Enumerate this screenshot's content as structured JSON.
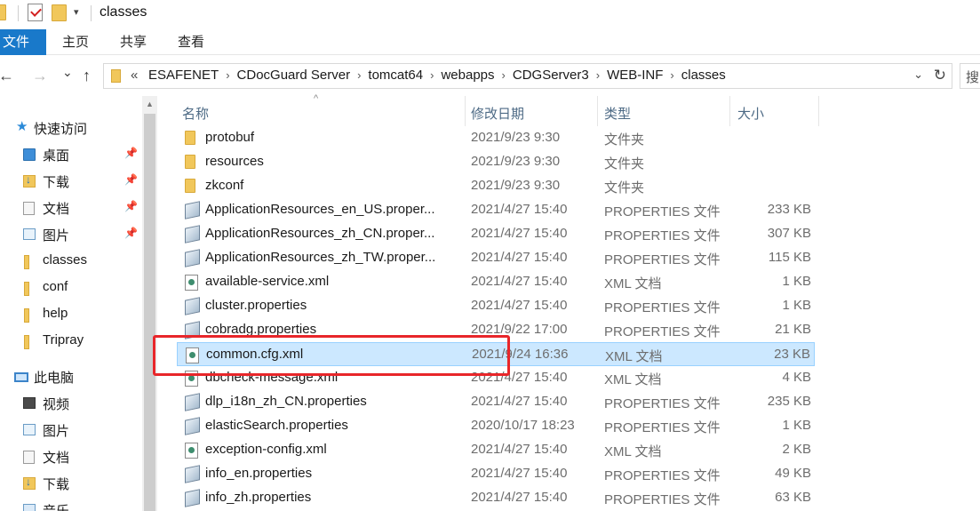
{
  "window": {
    "title": "classes"
  },
  "quick_access_toolbar": {
    "icons": [
      "folder-icon",
      "properties-icon",
      "new-folder-icon",
      "dropdown-icon"
    ],
    "dropdown_glyph": "▾"
  },
  "ribbon": {
    "tabs": [
      "文件",
      "主页",
      "共享",
      "查看"
    ],
    "active": "文件",
    "accent": "#1979ca"
  },
  "navigation": {
    "back": "←",
    "forward": "→",
    "recent": "⌄",
    "up": "↑",
    "overflow": "«",
    "breadcrumbs": [
      "ESAFENET",
      "CDocGuard Server",
      "tomcat64",
      "webapps",
      "CDGServer3",
      "WEB-INF",
      "classes"
    ],
    "crumb_sep": "›",
    "dropdown": "⌄",
    "refresh": "↻",
    "search_placeholder": "搜"
  },
  "sidebar": {
    "items": [
      {
        "label": "快速访问",
        "icon": "star-icon",
        "pinned": false
      },
      {
        "label": "桌面",
        "icon": "desktop-folder-icon",
        "pinned": true
      },
      {
        "label": "下载",
        "icon": "download-folder-icon",
        "pinned": true
      },
      {
        "label": "文档",
        "icon": "document-folder-icon",
        "pinned": true
      },
      {
        "label": "图片",
        "icon": "picture-folder-icon",
        "pinned": true
      },
      {
        "label": "classes",
        "icon": "folder-icon",
        "pinned": false
      },
      {
        "label": "conf",
        "icon": "folder-icon",
        "pinned": false
      },
      {
        "label": "help",
        "icon": "folder-icon",
        "pinned": false
      },
      {
        "label": "Tripray",
        "icon": "folder-icon",
        "pinned": false
      },
      {
        "label": "此电脑",
        "icon": "this-pc-icon",
        "pinned": false
      },
      {
        "label": "视频",
        "icon": "video-folder-icon",
        "pinned": false
      },
      {
        "label": "图片",
        "icon": "picture-folder-icon",
        "pinned": false
      },
      {
        "label": "文档",
        "icon": "document-folder-icon",
        "pinned": false
      },
      {
        "label": "下载",
        "icon": "download-folder-icon",
        "pinned": false
      },
      {
        "label": "音乐",
        "icon": "music-folder-icon",
        "pinned": false
      }
    ],
    "pin_glyph": "📌"
  },
  "columns": {
    "name": "名称",
    "date": "修改日期",
    "type": "类型",
    "size": "大小",
    "sort_caret": "^"
  },
  "files": [
    {
      "name": "protobuf",
      "date": "2021/9/23 9:30",
      "type": "文件夹",
      "size": "",
      "kind": "folder"
    },
    {
      "name": "resources",
      "date": "2021/9/23 9:30",
      "type": "文件夹",
      "size": "",
      "kind": "folder"
    },
    {
      "name": "zkconf",
      "date": "2021/9/23 9:30",
      "type": "文件夹",
      "size": "",
      "kind": "folder"
    },
    {
      "name": "ApplicationResources_en_US.proper...",
      "date": "2021/4/27 15:40",
      "type": "PROPERTIES 文件",
      "size": "233 KB",
      "kind": "properties"
    },
    {
      "name": "ApplicationResources_zh_CN.proper...",
      "date": "2021/4/27 15:40",
      "type": "PROPERTIES 文件",
      "size": "307 KB",
      "kind": "properties"
    },
    {
      "name": "ApplicationResources_zh_TW.proper...",
      "date": "2021/4/27 15:40",
      "type": "PROPERTIES 文件",
      "size": "115 KB",
      "kind": "properties"
    },
    {
      "name": "available-service.xml",
      "date": "2021/4/27 15:40",
      "type": "XML 文档",
      "size": "1 KB",
      "kind": "xml"
    },
    {
      "name": "cluster.properties",
      "date": "2021/4/27 15:40",
      "type": "PROPERTIES 文件",
      "size": "1 KB",
      "kind": "properties"
    },
    {
      "name": "cobradg.properties",
      "date": "2021/9/22 17:00",
      "type": "PROPERTIES 文件",
      "size": "21 KB",
      "kind": "properties"
    },
    {
      "name": "common.cfg.xml",
      "date": "2021/9/24 16:36",
      "type": "XML 文档",
      "size": "23 KB",
      "kind": "xml",
      "selected": true
    },
    {
      "name": "dbcheck-message.xml",
      "date": "2021/4/27 15:40",
      "type": "XML 文档",
      "size": "4 KB",
      "kind": "xml"
    },
    {
      "name": "dlp_i18n_zh_CN.properties",
      "date": "2021/4/27 15:40",
      "type": "PROPERTIES 文件",
      "size": "235 KB",
      "kind": "properties"
    },
    {
      "name": "elasticSearch.properties",
      "date": "2020/10/17 18:23",
      "type": "PROPERTIES 文件",
      "size": "1 KB",
      "kind": "properties"
    },
    {
      "name": "exception-config.xml",
      "date": "2021/4/27 15:40",
      "type": "XML 文档",
      "size": "2 KB",
      "kind": "xml"
    },
    {
      "name": "info_en.properties",
      "date": "2021/4/27 15:40",
      "type": "PROPERTIES 文件",
      "size": "49 KB",
      "kind": "properties"
    },
    {
      "name": "info_zh.properties",
      "date": "2021/4/27 15:40",
      "type": "PROPERTIES 文件",
      "size": "63 KB",
      "kind": "properties"
    }
  ],
  "annotation": {
    "color": "#e8262a"
  }
}
